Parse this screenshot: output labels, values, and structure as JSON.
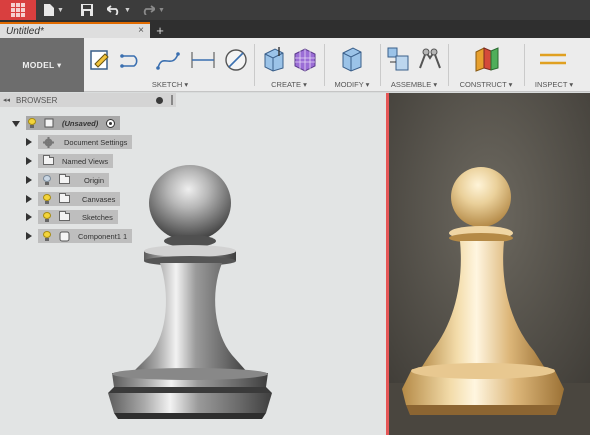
{
  "topbar": {
    "grid_icon": "app-grid-icon",
    "file_icon": "file-icon",
    "save_icon": "save-icon",
    "undo_icon": "undo-icon",
    "redo_icon": "redo-icon"
  },
  "tabs": {
    "document_tab": "Untitled*",
    "close_glyph": "×",
    "new_tab_glyph": "+"
  },
  "ribbon": {
    "workspace": "MODEL ▾",
    "groups": {
      "sketch": "SKETCH ▾",
      "create": "CREATE ▾",
      "modify": "MODIFY ▾",
      "assemble": "ASSEMBLE ▾",
      "construct": "CONSTRUCT ▾",
      "inspect": "INSPECT ▾"
    }
  },
  "browser": {
    "collapse_glyph": "◂◂",
    "title": "BROWSER",
    "root": "(Unsaved)",
    "items": [
      {
        "label": "Document Settings"
      },
      {
        "label": "Named Views"
      },
      {
        "label": "Origin"
      },
      {
        "label": "Canvases"
      },
      {
        "label": "Sketches"
      },
      {
        "label": "Component1 1"
      }
    ]
  },
  "colors": {
    "accent": "#e06a00",
    "topbar": "#3c3c3c",
    "grid_button": "#d93f3f",
    "viewport_bg": "#e2e4e4",
    "pawn_metal": "#8e8e8e",
    "photo_pawn": "#e9c98a"
  }
}
